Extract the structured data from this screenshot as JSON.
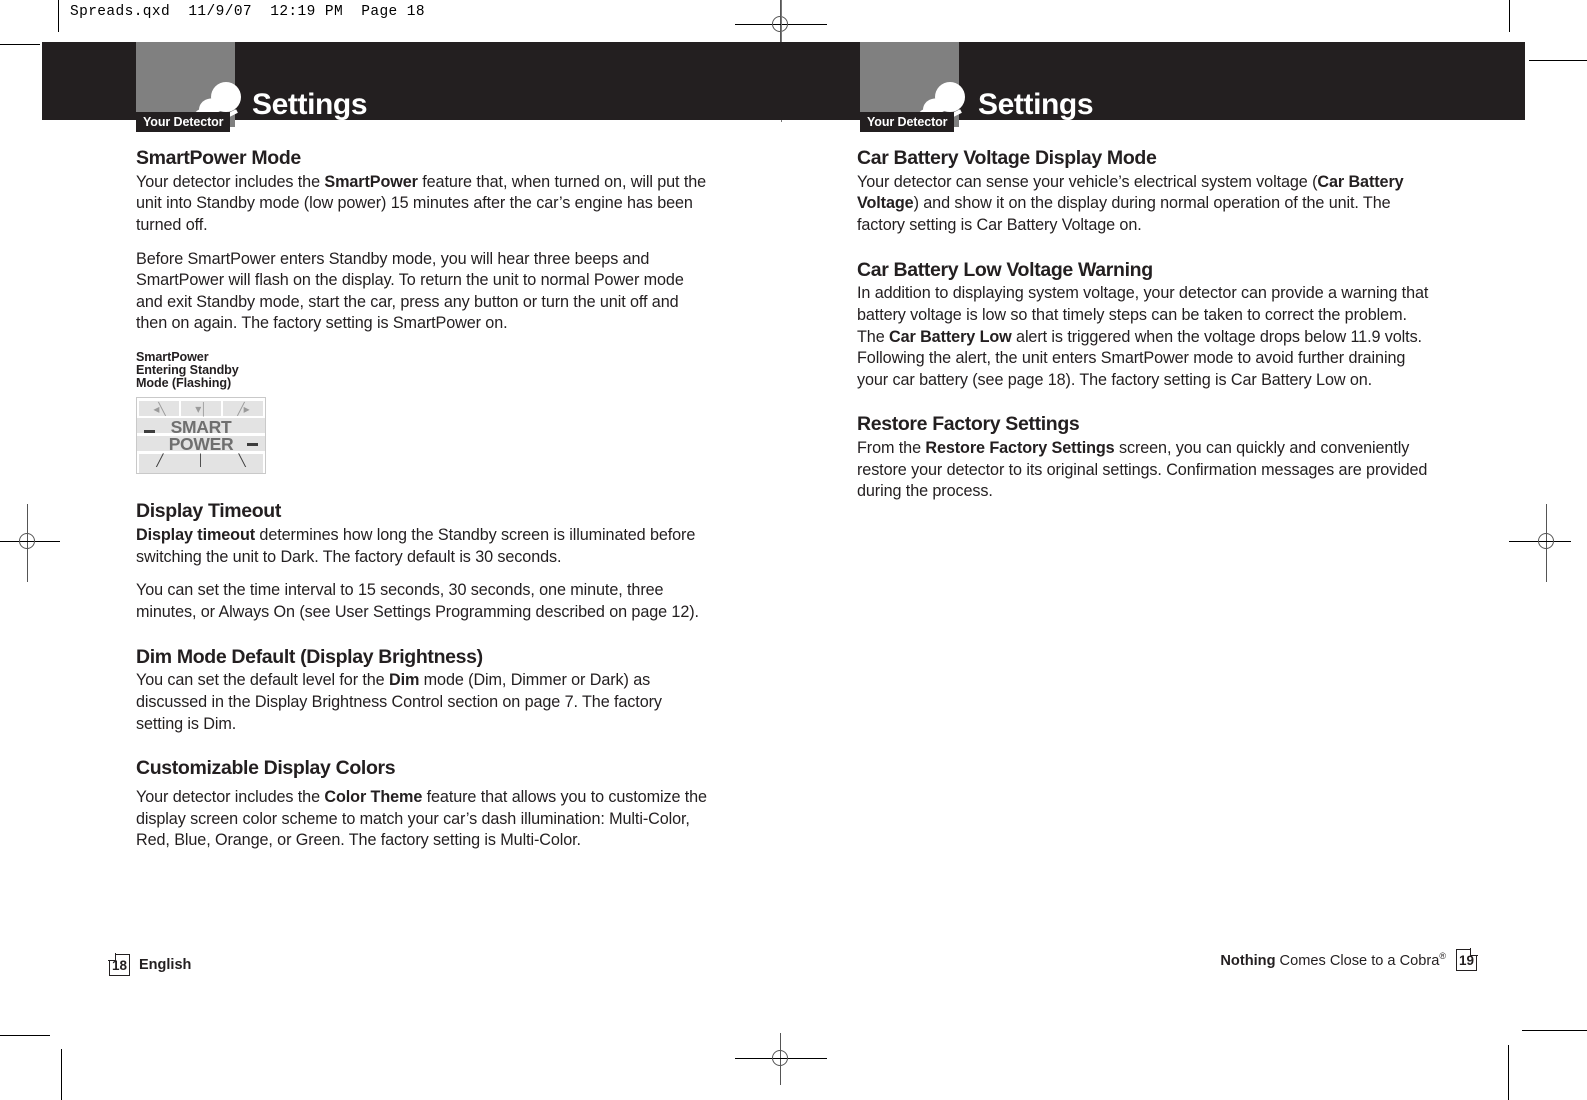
{
  "slug": "Spreads.qxd  11/9/07  12:19 PM  Page 18",
  "header": {
    "badge_label": "Your Detector",
    "badge_icon": "radar-detector-icon",
    "title_left": "Settings",
    "title_right": "Settings"
  },
  "left_page": {
    "sections": [
      {
        "heading": "SmartPower Mode",
        "paragraphs": [
          [
            {
              "t": "Your detector includes the ",
              "b": false
            },
            {
              "t": "SmartPower",
              "b": true
            },
            {
              "t": " feature that, when turned on, will put the unit into Standby mode (low power) 15 minutes after the car’s engine has been turned off.",
              "b": false
            }
          ],
          [
            {
              "t": "Before SmartPower enters Standby mode, you will hear three beeps and SmartPower will flash on the display. To return the unit to normal Power mode and exit Standby mode, start the car, press any button or turn the unit off and then on again. The factory setting is SmartPower on.",
              "b": false
            }
          ]
        ]
      },
      {
        "heading": "Display Timeout",
        "paragraphs": [
          [
            {
              "t": "Display timeout",
              "b": true
            },
            {
              "t": " determines how long the Standby screen is illuminated before switching the unit to Dark. The factory default is 30 seconds.",
              "b": false
            }
          ],
          [
            {
              "t": "You can set the time interval to 15 seconds, 30 seconds, one minute, three minutes, or Always On (see User Settings Programming described on page 12).",
              "b": false
            }
          ]
        ]
      },
      {
        "heading": "Dim Mode Default (Display Brightness)",
        "paragraphs": [
          [
            {
              "t": "You can set the default level for the ",
              "b": false
            },
            {
              "t": "Dim",
              "b": true
            },
            {
              "t": " mode (Dim, Dimmer or Dark) as discussed in the Display Brightness Control section on page 7. The factory setting is Dim.",
              "b": false
            }
          ]
        ]
      },
      {
        "heading": "Customizable Display Colors",
        "paragraphs": [
          [
            {
              "t": "Your detector includes the ",
              "b": false
            },
            {
              "t": "Color Theme",
              "b": true
            },
            {
              "t": " feature that allows you to customize the display screen color scheme to match your car’s dash illumination: Multi-Color, Red, Blue, Orange, or Green. The factory setting is Multi-Color.",
              "b": false
            }
          ]
        ]
      }
    ],
    "figure": {
      "caption": "SmartPower\nEntering Standby\nMode (Flashing)",
      "lcd_line1": "SMART",
      "lcd_line2": "POWER",
      "lcd_arrows_top_left": "◂╲",
      "lcd_arrows_top_center": "▾│",
      "lcd_arrows_top_right": "╱▸",
      "lcd_marks_bottom": [
        "╱",
        "│",
        "╲"
      ]
    }
  },
  "right_page": {
    "sections": [
      {
        "heading": "Car Battery Voltage Display Mode",
        "paragraphs": [
          [
            {
              "t": "Your detector can sense your vehicle’s electrical system voltage (",
              "b": false
            },
            {
              "t": "Car Battery Voltage",
              "b": true
            },
            {
              "t": ") and show it on the display during normal operation of the unit. The factory setting is Car Battery Voltage on.",
              "b": false
            }
          ]
        ]
      },
      {
        "heading": "Car Battery Low Voltage Warning",
        "paragraphs": [
          [
            {
              "t": "In addition to displaying system voltage, your detector can provide a warning that battery voltage is low so that timely steps can be taken to correct the problem. The ",
              "b": false
            },
            {
              "t": "Car Battery Low",
              "b": true
            },
            {
              "t": " alert is triggered when the voltage drops below 11.9 volts. Following the alert, the unit enters SmartPower mode to avoid further draining your car battery (see page 18). The factory setting is Car Battery Low on.",
              "b": false
            }
          ]
        ]
      },
      {
        "heading": "Restore Factory Settings",
        "paragraphs": [
          [
            {
              "t": "From the ",
              "b": false
            },
            {
              "t": "Restore Factory Settings",
              "b": true
            },
            {
              "t": " screen, you can quickly and conveniently restore your detector to its original settings. Confirmation messages are provided during the process.",
              "b": false
            }
          ]
        ]
      }
    ]
  },
  "footer": {
    "left_page_number": "18",
    "left_language": "English",
    "tagline_bold": "Nothing",
    "tagline_rest": " Comes Close to a Cobra",
    "tagline_mark": "®",
    "right_page_number": "19"
  },
  "colors": {
    "bar": "#231f20",
    "badge": "#808080",
    "lcd_band": "#e3e3e3",
    "lcd_text": "#6f6f6f",
    "text": "#231f20"
  }
}
